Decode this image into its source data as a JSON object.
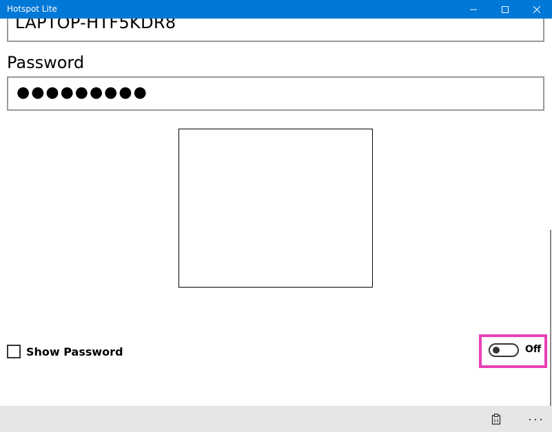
{
  "window": {
    "title": "Hotspot Lite"
  },
  "form": {
    "ssid_value": "LAPTOP-HTF5KDR8",
    "password_label": "Password",
    "password_value": "●●●●●●●●●",
    "show_password_label": "Show Password",
    "show_password_checked": false
  },
  "hotspot_toggle": {
    "state_label": "Off",
    "on": false,
    "highlight_color": "#e83fb6"
  },
  "appbar": {
    "more_label": "···"
  },
  "colors": {
    "titlebar": "#0078d7",
    "appbar": "#e6e6e6"
  },
  "icons": {
    "minimize": "minimize-icon",
    "maximize": "maximize-icon",
    "close": "close-icon",
    "clipboard": "clipboard-icon",
    "more": "more-icon"
  }
}
